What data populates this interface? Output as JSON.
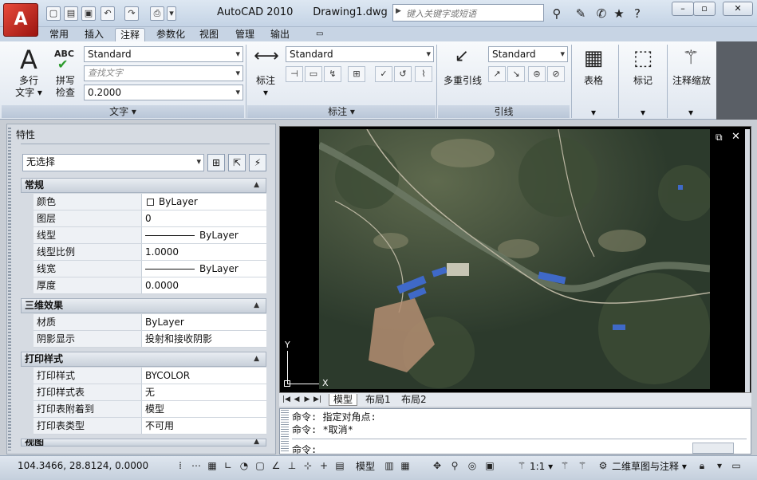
{
  "title_bar": {
    "app": "AutoCAD 2010",
    "document": "Drawing1.dwg",
    "search_placeholder": "键入关键字或短语"
  },
  "tabs": [
    "常用",
    "插入",
    "注释",
    "参数化",
    "视图",
    "管理",
    "输出"
  ],
  "active_tab": "注释",
  "ribbon": {
    "text_panel": {
      "label": "文字",
      "multiline_line1": "多行",
      "multiline_line2": "文字",
      "spell_line1": "拼写",
      "spell_line2": "检查",
      "spell_icon_text": "ABC",
      "style": "Standard",
      "find_placeholder": "查找文字",
      "height": "0.2000"
    },
    "dim_panel": {
      "label": "标注",
      "button": "标注",
      "style": "Standard"
    },
    "leader_panel": {
      "label": "引线",
      "button": "多重引线",
      "style": "Standard"
    },
    "table_button": "表格",
    "mark_button": "标记",
    "scale_button": "注释缩放"
  },
  "properties": {
    "title": "特性",
    "selection": "无选择",
    "sections": [
      {
        "name": "常规",
        "rows": [
          [
            "颜色",
            "ByLayer"
          ],
          [
            "图层",
            "0"
          ],
          [
            "线型",
            "ByLayer"
          ],
          [
            "线型比例",
            "1.0000"
          ],
          [
            "线宽",
            "ByLayer"
          ],
          [
            "厚度",
            "0.0000"
          ]
        ]
      },
      {
        "name": "三维效果",
        "rows": [
          [
            "材质",
            "ByLayer"
          ],
          [
            "阴影显示",
            "投射和接收阴影"
          ]
        ]
      },
      {
        "name": "打印样式",
        "rows": [
          [
            "打印样式",
            "BYCOLOR"
          ],
          [
            "打印样式表",
            "无"
          ],
          [
            "打印表附着到",
            "模型"
          ],
          [
            "打印表类型",
            "不可用"
          ]
        ]
      },
      {
        "name": "视图",
        "rows": []
      }
    ]
  },
  "layout_tabs": [
    "模型",
    "布局1",
    "布局2"
  ],
  "ucs": {
    "x": "X",
    "y": "Y"
  },
  "command": {
    "line1": "命令: 指定对角点:",
    "line2": "命令: *取消*",
    "prompt": "命令:"
  },
  "status": {
    "coords": "104.3466, 28.8124, 0.0000",
    "model": "模型",
    "scale": "1:1",
    "workspace": "二维草图与注释"
  }
}
